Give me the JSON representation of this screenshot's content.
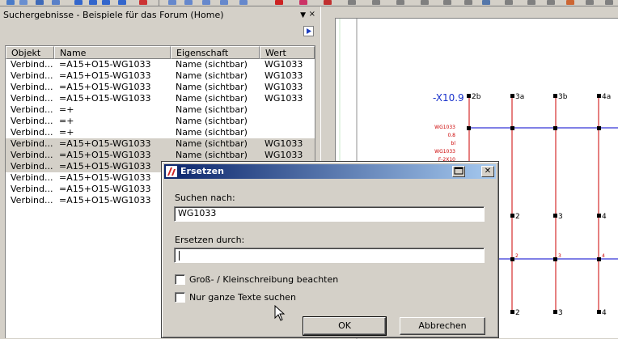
{
  "panel": {
    "title": "Suchergebnisse - Beispiele für das Forum (Home)",
    "pin_glyph": "▼",
    "close_glyph": "×",
    "columns": [
      "Objekt",
      "Name",
      "Eigenschaft",
      "Wert"
    ],
    "rows": [
      {
        "objekt": "Verbind...",
        "name": "=A15+O15-WG1033",
        "eigenschaft": "Name (sichtbar)",
        "wert": "WG1033",
        "selected": false
      },
      {
        "objekt": "Verbind...",
        "name": "=A15+O15-WG1033",
        "eigenschaft": "Name (sichtbar)",
        "wert": "WG1033",
        "selected": false
      },
      {
        "objekt": "Verbind...",
        "name": "=A15+O15-WG1033",
        "eigenschaft": "Name (sichtbar)",
        "wert": "WG1033",
        "selected": false
      },
      {
        "objekt": "Verbind...",
        "name": "=A15+O15-WG1033",
        "eigenschaft": "Name (sichtbar)",
        "wert": "WG1033",
        "selected": false
      },
      {
        "objekt": "Verbind...",
        "name": "=+",
        "eigenschaft": "Name (sichtbar)",
        "wert": "",
        "selected": false
      },
      {
        "objekt": "Verbind...",
        "name": "=+",
        "eigenschaft": "Name (sichtbar)",
        "wert": "",
        "selected": false
      },
      {
        "objekt": "Verbind...",
        "name": "=+",
        "eigenschaft": "Name (sichtbar)",
        "wert": "",
        "selected": false
      },
      {
        "objekt": "Verbind...",
        "name": "=A15+O15-WG1033",
        "eigenschaft": "Name (sichtbar)",
        "wert": "WG1033",
        "selected": true
      },
      {
        "objekt": "Verbind...",
        "name": "=A15+O15-WG1033",
        "eigenschaft": "Name (sichtbar)",
        "wert": "WG1033",
        "selected": true
      },
      {
        "objekt": "Verbind...",
        "name": "=A15+O15-WG1033",
        "eigenschaft": "",
        "wert": "",
        "selected": true
      },
      {
        "objekt": "Verbind...",
        "name": "=A15+O15-WG1033",
        "eigenschaft": "",
        "wert": "",
        "selected": false
      },
      {
        "objekt": "Verbind...",
        "name": "=A15+O15-WG1033",
        "eigenschaft": "",
        "wert": "",
        "selected": false
      },
      {
        "objekt": "Verbind...",
        "name": "=A15+O15-WG1033",
        "eigenschaft": "",
        "wert": "",
        "selected": false
      }
    ]
  },
  "drawing": {
    "device_label": "-X10.9",
    "terminal_top": [
      "2b",
      "3a",
      "3b",
      "4a"
    ],
    "terminal_mid": [
      "2",
      "3",
      "4"
    ],
    "terminal_small": [
      "2",
      "3",
      "4"
    ],
    "terminal_bottom": [
      "2",
      "3",
      "4"
    ],
    "wire_labels": [
      "WG1033",
      "0.8",
      "bl",
      "WG1033",
      "F-2X10"
    ],
    "colors": {
      "wire_blue": "#0000cc",
      "wire_red": "#cc0000",
      "label_blue": "#1a33cc"
    }
  },
  "dialog": {
    "title": "Ersetzen",
    "search_label": "Suchen nach:",
    "search_value": "WG1033",
    "replace_label": "Ersetzen durch:",
    "replace_value": "",
    "case_label": "Groß- / Kleinschreibung beachten",
    "case_checked": false,
    "whole_label": "Nur ganze Texte suchen",
    "whole_checked": false,
    "ok_label": "OK",
    "cancel_label": "Abbrechen",
    "close_glyph": "✕"
  }
}
